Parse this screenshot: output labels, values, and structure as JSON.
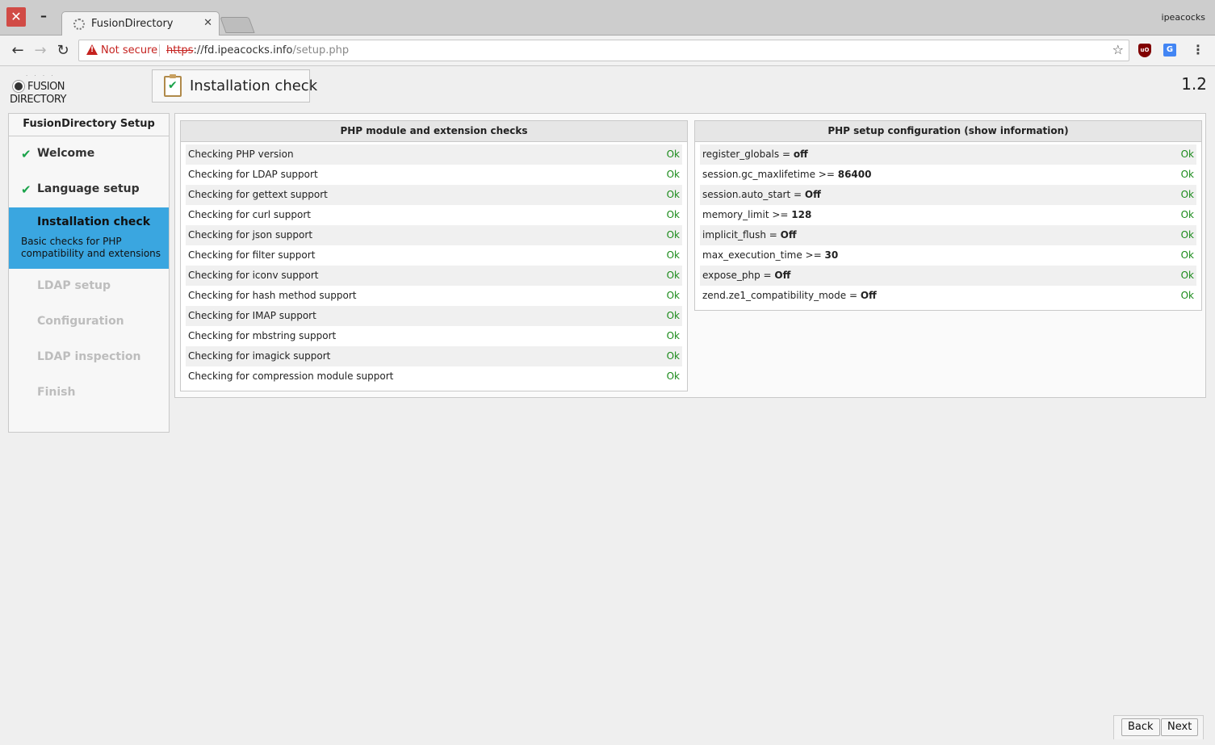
{
  "browser": {
    "tab_title": "FusionDirectory",
    "profile_name": "ipeacocks",
    "security_label": "Not secure",
    "url_scheme": "https",
    "url_sep": "://",
    "url_host": "fd.ipeacocks.info",
    "url_path": "/setup.php"
  },
  "header": {
    "logo_line1": "FUSION",
    "logo_line2": "DIRECTORY",
    "step_title": "Installation check",
    "version": "1.2"
  },
  "sidebar": {
    "title": "FusionDirectory Setup",
    "steps": [
      {
        "label": "Welcome",
        "state": "done"
      },
      {
        "label": "Language setup",
        "state": "done"
      },
      {
        "label": "Installation check",
        "state": "active",
        "desc": "Basic checks for PHP compatibility and extensions"
      },
      {
        "label": "LDAP setup",
        "state": "disabled"
      },
      {
        "label": "Configuration",
        "state": "disabled"
      },
      {
        "label": "LDAP inspection",
        "state": "disabled"
      },
      {
        "label": "Finish",
        "state": "disabled"
      }
    ]
  },
  "modules": {
    "title": "PHP module and extension checks",
    "rows": [
      {
        "label": "Checking PHP version",
        "status": "Ok"
      },
      {
        "label": "Checking for LDAP support",
        "status": "Ok"
      },
      {
        "label": "Checking for gettext support",
        "status": "Ok"
      },
      {
        "label": "Checking for curl support",
        "status": "Ok"
      },
      {
        "label": "Checking for json support",
        "status": "Ok"
      },
      {
        "label": "Checking for filter support",
        "status": "Ok"
      },
      {
        "label": "Checking for iconv support",
        "status": "Ok"
      },
      {
        "label": "Checking for hash method support",
        "status": "Ok"
      },
      {
        "label": "Checking for IMAP support",
        "status": "Ok"
      },
      {
        "label": "Checking for mbstring support",
        "status": "Ok"
      },
      {
        "label": "Checking for imagick support",
        "status": "Ok"
      },
      {
        "label": "Checking for compression module support",
        "status": "Ok"
      }
    ]
  },
  "config": {
    "title": "PHP setup configuration (show information)",
    "rows": [
      {
        "key": "register_globals = ",
        "value": "off",
        "status": "Ok"
      },
      {
        "key": "session.gc_maxlifetime >= ",
        "value": "86400",
        "status": "Ok"
      },
      {
        "key": "session.auto_start = ",
        "value": "Off",
        "status": "Ok"
      },
      {
        "key": "memory_limit >= ",
        "value": "128",
        "status": "Ok"
      },
      {
        "key": "implicit_flush = ",
        "value": "Off",
        "status": "Ok"
      },
      {
        "key": "max_execution_time >= ",
        "value": "30",
        "status": "Ok"
      },
      {
        "key": "expose_php = ",
        "value": "Off",
        "status": "Ok"
      },
      {
        "key": "zend.ze1_compatibility_mode = ",
        "value": "Off",
        "status": "Ok"
      }
    ]
  },
  "buttons": {
    "back": "Back",
    "next": "Next"
  },
  "icons": {
    "close": "close-icon",
    "minimize": "minimize-icon",
    "back": "arrow-left-icon",
    "forward": "arrow-right-icon",
    "reload": "reload-icon",
    "warning": "warning-icon",
    "bookmark": "star-icon",
    "menu": "kebab-menu-icon",
    "check": "checkmark-icon"
  },
  "colors": {
    "active_step": "#3aa6e0",
    "ok_text": "#1a8a1a",
    "warning": "#c5221f",
    "check": "#1aa34a"
  }
}
